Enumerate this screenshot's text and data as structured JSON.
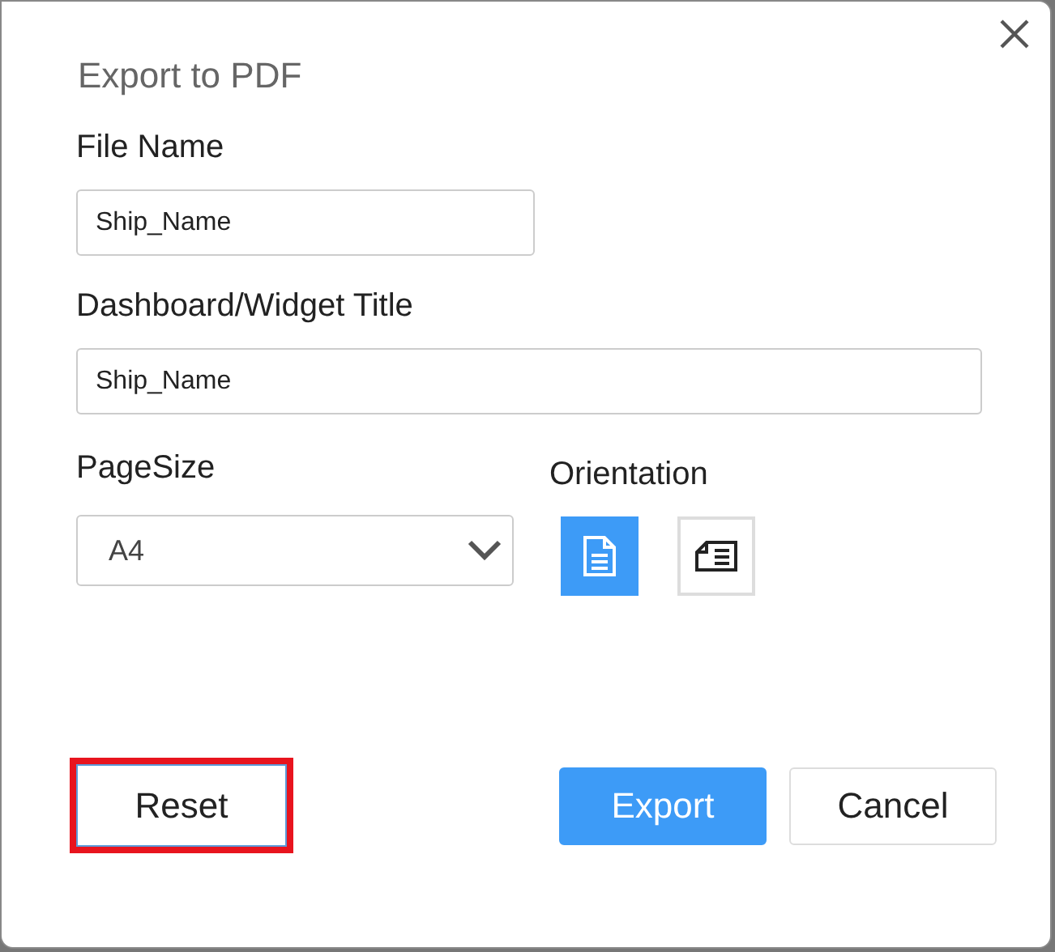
{
  "dialog": {
    "title": "Export to PDF"
  },
  "file_name": {
    "label": "File Name",
    "value": "Ship_Name"
  },
  "title_field": {
    "label": "Dashboard/Widget Title",
    "value": "Ship_Name"
  },
  "page_size": {
    "label": "PageSize",
    "value": "A4"
  },
  "orientation": {
    "label": "Orientation",
    "options": [
      {
        "kind": "portrait",
        "selected": true
      },
      {
        "kind": "landscape",
        "selected": false
      }
    ]
  },
  "buttons": [
    {
      "kind": "reset",
      "label": "Reset",
      "highlighted": true
    },
    {
      "kind": "export",
      "label": "Export",
      "highlighted": false
    },
    {
      "kind": "cancel",
      "label": "Cancel",
      "highlighted": false
    }
  ]
}
